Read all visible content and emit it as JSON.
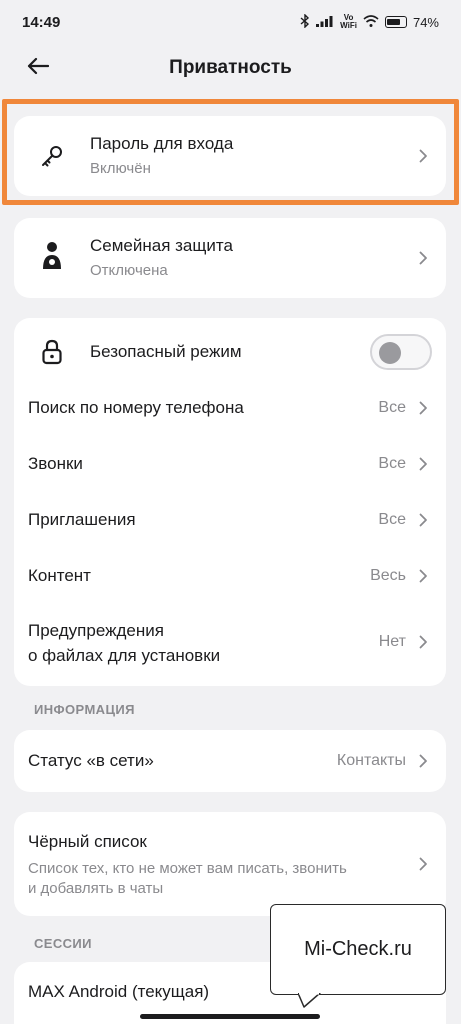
{
  "status_bar": {
    "time": "14:49",
    "vowifi_top": "Vo",
    "vowifi_bottom": "WiFi",
    "battery": "74%"
  },
  "header": {
    "title": "Приватность"
  },
  "login_password": {
    "title": "Пароль для входа",
    "subtitle": "Включён",
    "icon": "key-icon"
  },
  "family_protection": {
    "title": "Семейная защита",
    "subtitle": "Отключена",
    "icon": "person-shield-icon"
  },
  "settings": {
    "safe_mode": {
      "title": "Безопасный режим",
      "enabled": false,
      "icon": "lock-icon"
    },
    "items": [
      {
        "title": "Поиск по номеру телефона",
        "value": "Все"
      },
      {
        "title": "Звонки",
        "value": "Все"
      },
      {
        "title": "Приглашения",
        "value": "Все"
      },
      {
        "title": "Контент",
        "value": "Весь"
      },
      {
        "title_line1": "Предупреждения",
        "title_line2": "о файлах для установки",
        "value": "Нет"
      }
    ]
  },
  "info_section": {
    "label": "ИНФОРМАЦИЯ",
    "online_status": {
      "title": "Статус «в сети»",
      "value": "Контакты"
    }
  },
  "blacklist": {
    "title": "Чёрный список",
    "subtitle_line1": "Список тех, кто не может вам писать, звонить",
    "subtitle_line2": "и добавлять в чаты"
  },
  "sessions_section": {
    "label": "СЕССИИ",
    "current": "MAX Android (текущая)"
  },
  "watermark": "Mi-Check.ru",
  "colors": {
    "background": "#f1f1f3",
    "card": "#ffffff",
    "highlight": "#f0873a",
    "secondary_text": "#8a8a8e"
  }
}
